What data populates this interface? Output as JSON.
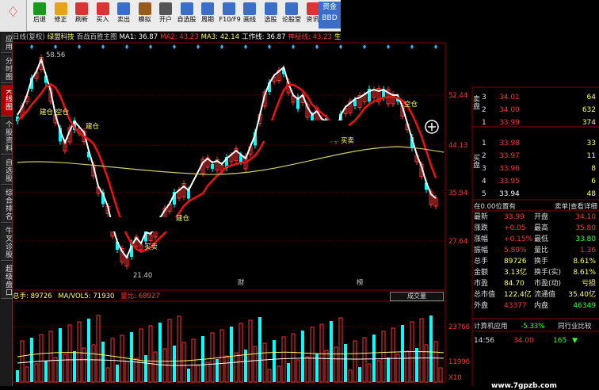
{
  "toolbar": {
    "buttons": [
      {
        "label": "",
        "icon": "home",
        "color": "#d33"
      },
      {
        "label": "后退",
        "icon": "back",
        "color": "#1a9a1a"
      },
      {
        "label": "修正",
        "icon": "refresh",
        "color": "#e6a21b"
      },
      {
        "label": "刷新",
        "icon": "stop",
        "color": "#d33"
      },
      {
        "label": "买入",
        "icon": "buy",
        "color": "#d33"
      },
      {
        "label": "卖出",
        "icon": "sell",
        "color": "#3b6ec8"
      },
      {
        "label": "模拟",
        "icon": "hammer",
        "color": "#9a5a1a"
      },
      {
        "label": "开户",
        "icon": "bank",
        "color": "#555"
      },
      {
        "label": "自选股",
        "icon": "star-list",
        "color": "#3b6ec8"
      },
      {
        "label": "周期",
        "icon": "calendar",
        "color": "#3b6ec8"
      },
      {
        "label": "F10/F9",
        "icon": "grid",
        "color": "#3b6ec8"
      },
      {
        "label": "画线",
        "icon": "pen",
        "color": "#3b6ec8"
      },
      {
        "label": "选股",
        "icon": "magnifier",
        "color": "#3b6ec8"
      },
      {
        "label": "论股堂",
        "icon": "chat",
        "color": "#3b6ec8"
      },
      {
        "label": "资讯",
        "icon": "news",
        "color": "#d33"
      }
    ],
    "zijin_label": "资金",
    "bbd_label": "BBD"
  },
  "sidebar": [
    "应用",
    "分时图",
    "K线图",
    "个股资料",
    "自选股",
    "综合排名",
    "牛叉诊股",
    "超级盘口"
  ],
  "ma_bar": [
    {
      "text": "日线(复权)",
      "color": "#cccccc"
    },
    {
      "text": "绿盟科技",
      "color": "#ffff66"
    },
    {
      "text": "百战百胜主图",
      "color": "#cccccc"
    },
    {
      "text": "MA1: 36.87",
      "color": "#ffffff"
    },
    {
      "text": "MA2: 43.23",
      "color": "#ff3333"
    },
    {
      "text": "MA3: 42.14",
      "color": "#ffff66"
    },
    {
      "text": "工作线: 36.87",
      "color": "#ffffff"
    },
    {
      "text": "神秘线: 43.23",
      "color": "#ff3333"
    },
    {
      "text": "生命线: 4",
      "color": "#ffff66"
    }
  ],
  "chart_data": {
    "type": "candlestick",
    "price_axis": [
      "52.44",
      "44.13",
      "35.94",
      "27.64"
    ],
    "volume_axis": [
      "23766",
      "11996",
      "X10"
    ],
    "annotations": [
      "58.56",
      "21.40",
      "建仓",
      "空仓",
      "建仓",
      "建仓",
      "买卖",
      "财",
      "榜",
      "买卖",
      "空仓"
    ],
    "volume_title": "总手: 89726",
    "volume_ma": "MA/VOL5: 71930",
    "volume_ratio": "量比: 68927",
    "volume_button": "成交量"
  },
  "order_book": {
    "sell_label": "卖盘",
    "buy_label": "买盘",
    "rows": [
      {
        "n": "3",
        "price": "34.01",
        "vol": "64",
        "color": "#ff3333"
      },
      {
        "n": "2",
        "price": "34.00",
        "vol": "632",
        "color": "#ff3333"
      },
      {
        "n": "1",
        "price": "33.99",
        "vol": "374",
        "color": "#ff3333"
      },
      {
        "n": "1",
        "price": "33.98",
        "vol": "33",
        "color": "#ff3333"
      },
      {
        "n": "2",
        "price": "33.97",
        "vol": "11",
        "color": "#ff3333"
      },
      {
        "n": "3",
        "price": "33.96",
        "vol": "8",
        "color": "#ff3333"
      },
      {
        "n": "4",
        "price": "33.95",
        "vol": "6",
        "color": "#ff3333"
      },
      {
        "n": "5",
        "price": "33.94",
        "vol": "48",
        "color": "#ffffff"
      }
    ]
  },
  "panel": {
    "title": "在0.00位置有",
    "link": "卖单|查看详细",
    "stats": [
      {
        "l": "最新",
        "lv": "33.99",
        "r": "开盘",
        "rv": "34.10",
        "lc": "#ff3333",
        "rc": "#ff3333"
      },
      {
        "l": "涨跌",
        "lv": "+0.05",
        "r": "最高",
        "rv": "35.80",
        "lc": "#ff3333",
        "rc": "#ff3333"
      },
      {
        "l": "涨幅",
        "lv": "+0.15%",
        "r": "最低",
        "rv": "33.80",
        "lc": "#ff3333",
        "rc": "#33ff33"
      },
      {
        "l": "振幅",
        "lv": "5.89%",
        "r": "量比",
        "rv": "1.36",
        "lc": "#ff3333",
        "rc": "#ff3333"
      },
      {
        "l": "总手",
        "lv": "89726",
        "r": "换手",
        "rv": "8.61%",
        "lc": "#ffff66",
        "rc": "#ffff66"
      },
      {
        "l": "金额",
        "lv": "3.13亿",
        "r": "换手(实)",
        "rv": "8.61%",
        "lc": "#ffff66",
        "rc": "#ffff66"
      },
      {
        "l": "市盈",
        "lv": "84.70",
        "r": "市盈(动)",
        "rv": "亏损",
        "lc": "#ffff66",
        "rc": "#ffff66"
      },
      {
        "l": "总市值",
        "lv": "122.4亿",
        "r": "流通值",
        "rv": "35.40亿",
        "lc": "#ffff66",
        "rc": "#ffff66"
      },
      {
        "l": "外盘",
        "lv": "43377",
        "r": "内盘",
        "rv": "46349",
        "lc": "#ff3333",
        "rc": "#33ff33"
      }
    ],
    "footer": [
      "计算机应用",
      "-5.33%",
      "同行业比较"
    ],
    "tick": {
      "time": "14:56",
      "price": "34.00",
      "vol": "165"
    }
  },
  "watermark": "www.7gpzb.com"
}
